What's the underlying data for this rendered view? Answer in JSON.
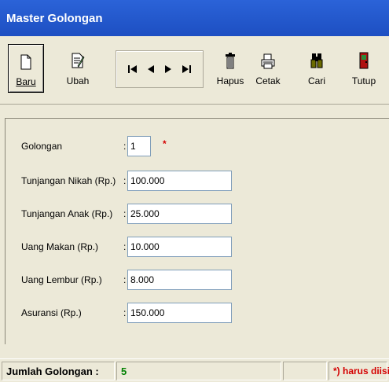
{
  "window": {
    "title": "Master Golongan"
  },
  "toolbar": {
    "baru": "Baru",
    "ubah": "Ubah",
    "hapus": "Hapus",
    "cetak": "Cetak",
    "cari": "Cari",
    "tutup": "Tutup"
  },
  "form": {
    "fields": [
      {
        "label": "Golongan",
        "value": "1"
      },
      {
        "label": "Tunjangan Nikah (Rp.)",
        "value": "100.000"
      },
      {
        "label": "Tunjangan Anak (Rp.)",
        "value": "25.000"
      },
      {
        "label": "Uang Makan (Rp.)",
        "value": "10.000"
      },
      {
        "label": "Uang Lembur (Rp.)",
        "value": "8.000"
      },
      {
        "label": "Asuransi (Rp.)",
        "value": "150.000"
      }
    ],
    "colon": ":",
    "required_mark": "*"
  },
  "status": {
    "label": "Jumlah Golongan :",
    "count": "5",
    "note": "*) harus diisi"
  },
  "colors": {
    "title_bar": "#1d4fc2",
    "required": "#d40000",
    "count": "#008000"
  }
}
